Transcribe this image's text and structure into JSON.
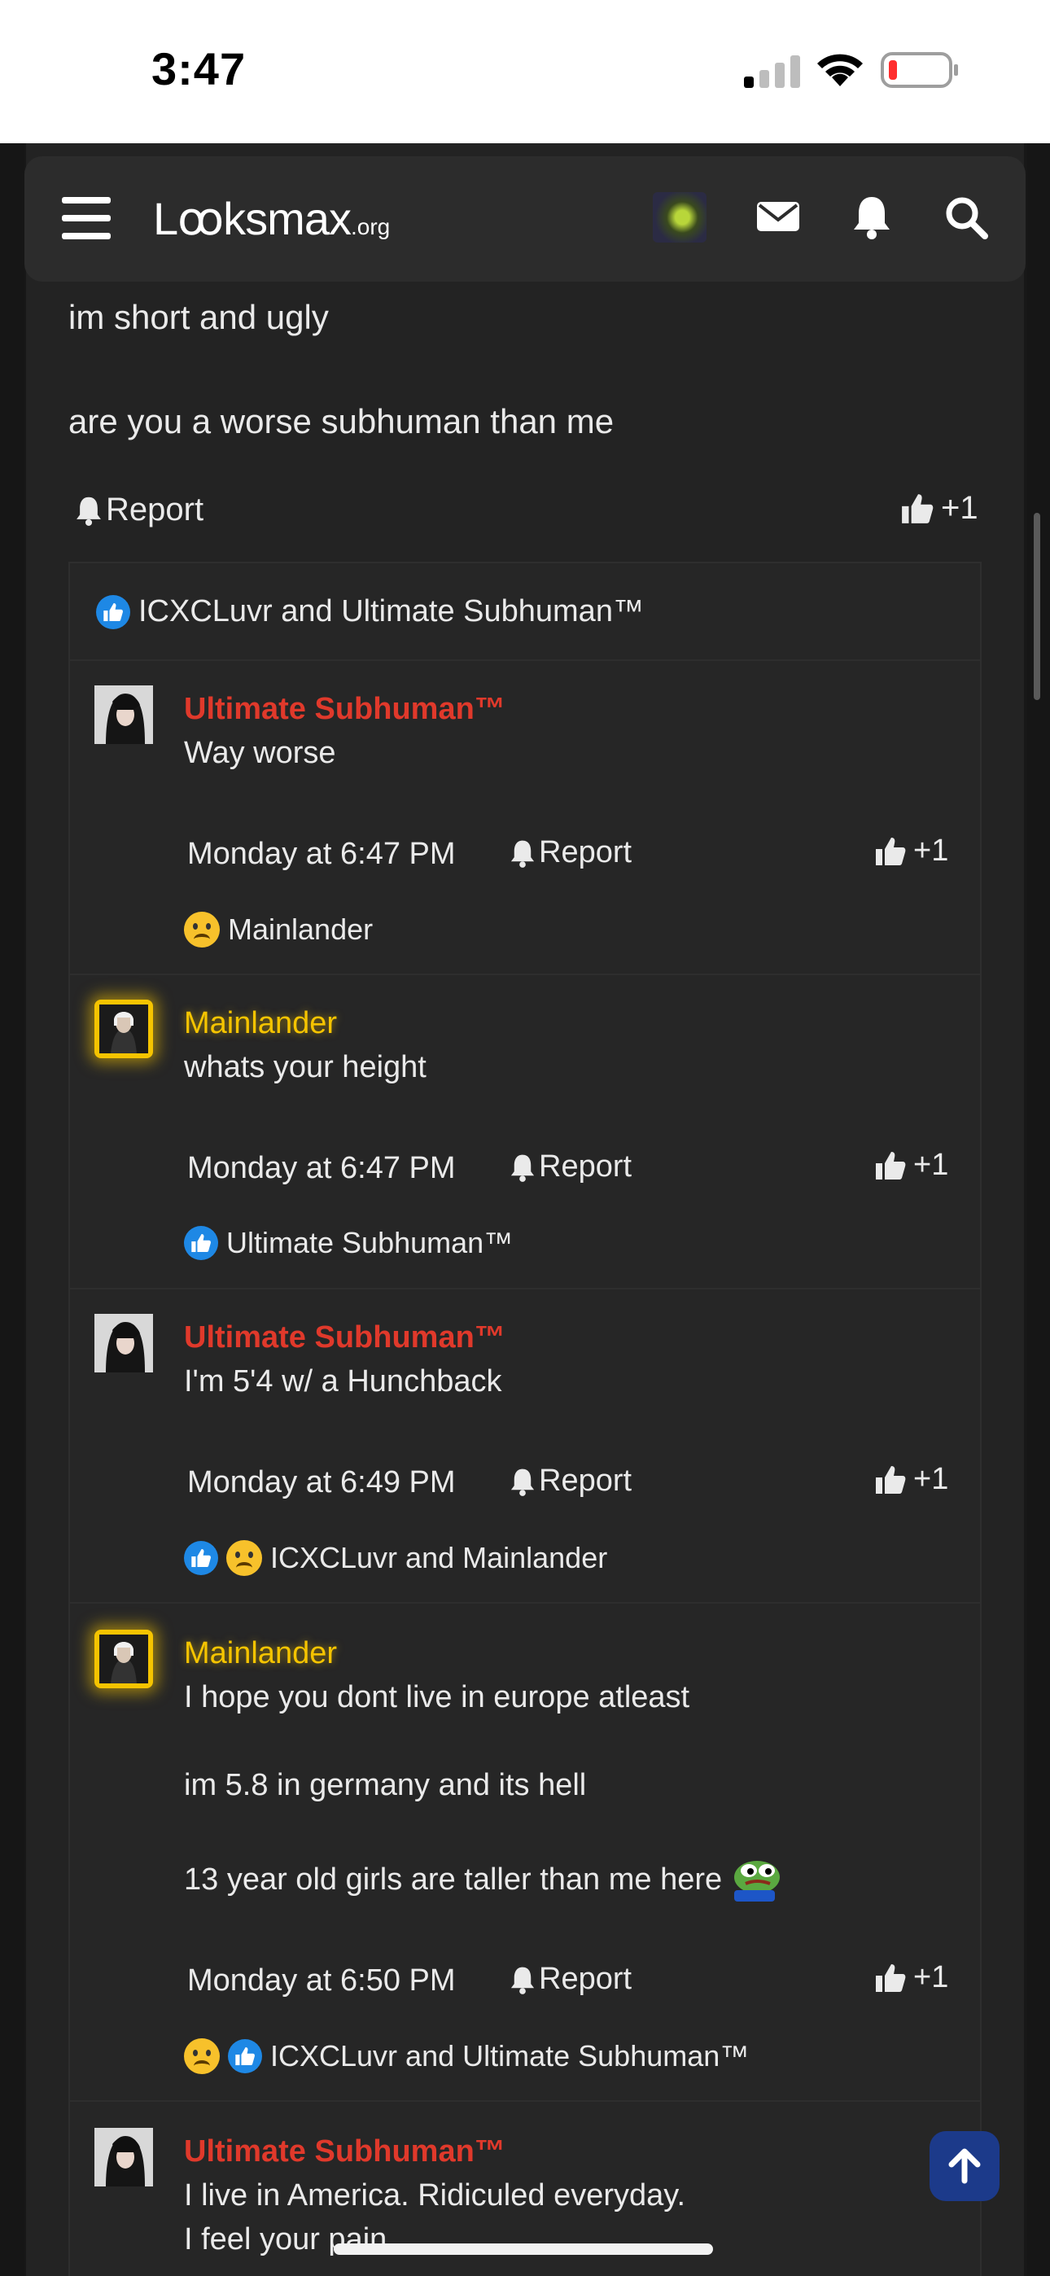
{
  "status_bar": {
    "time": "3:47"
  },
  "header": {
    "logo_main": "Lꝏksmax",
    "logo_suffix": ".org"
  },
  "post": {
    "lines": [
      "im short and ugly",
      "are you a worse subhuman than me"
    ],
    "report_label": "Report",
    "like_label": "+1"
  },
  "likes_summary": "ICXCLuvr and Ultimate Subhuman™",
  "replies": [
    {
      "author": "Ultimate Subhuman™",
      "lines": [
        "Way worse"
      ],
      "time": "Monday at 6:47 PM",
      "report_label": "Report",
      "like_label": "+1",
      "reactions_text": "Mainlander"
    },
    {
      "author": "Mainlander",
      "lines": [
        "whats your height"
      ],
      "time": "Monday at 6:47 PM",
      "report_label": "Report",
      "like_label": "+1",
      "reactions_text": "Ultimate Subhuman™"
    },
    {
      "author": "Ultimate Subhuman™",
      "lines": [
        "I'm 5'4 w/ a Hunchback"
      ],
      "time": "Monday at 6:49 PM",
      "report_label": "Report",
      "like_label": "+1",
      "reactions_text": "ICXCLuvr and Mainlander"
    },
    {
      "author": "Mainlander",
      "lines": [
        "I hope you dont live in europe atleast",
        "im 5.8 in germany and its hell",
        "13 year old girls are taller than me here"
      ],
      "time": "Monday at 6:50 PM",
      "report_label": "Report",
      "like_label": "+1",
      "reactions_text": "ICXCLuvr and Ultimate Subhuman™"
    },
    {
      "author": "Ultimate Subhuman™",
      "lines": [
        "I live in America. Ridiculed everyday.",
        "I feel your pain"
      ]
    }
  ],
  "colors": {
    "background": "#232323",
    "subhuman_name": "#e0392b",
    "mainlander_name": "#f5c400",
    "like_badge": "#1e88e5",
    "scroll_top_button": "#1c3a8a"
  },
  "icons": [
    "hamburger-icon",
    "envelope-icon",
    "bell-icon",
    "search-icon",
    "thumbs-up-icon",
    "arrow-up-icon",
    "pepe-emoji"
  ]
}
